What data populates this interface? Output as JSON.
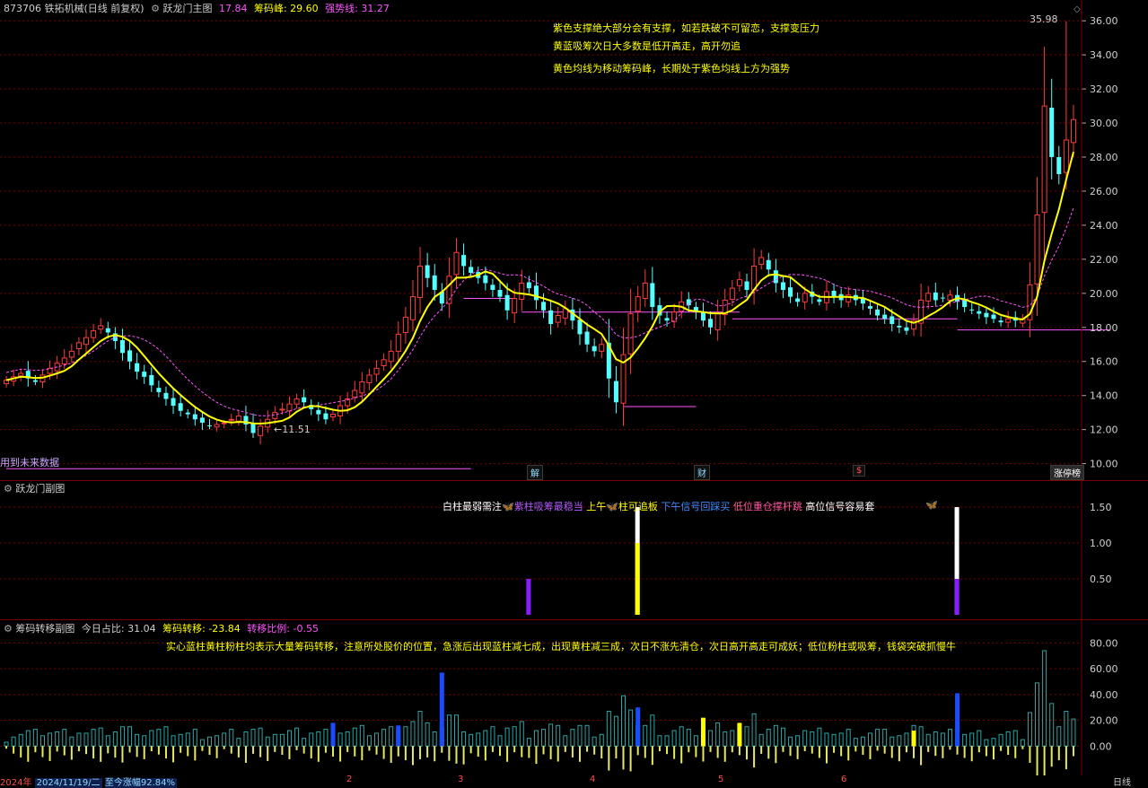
{
  "header": {
    "security": "873706 铁拓机械(日线 前复权)",
    "main_title": "跃龙门主图",
    "main_val_1": "17.84",
    "label_chip_peak": "筹码峰:",
    "val_chip_peak": "29.60",
    "label_strong": "强势线:",
    "val_strong": "31.27"
  },
  "notes": {
    "line1": "紫色支撑绝大部分会有支撑，如若跌破不可留恋，支撑变压力",
    "line2": "黄蓝吸筹次日大多数是低开高走，高开勿追",
    "line3": "黄色均线为移动筹码峰，长期处于紫色均线上方为强势"
  },
  "future_text": "用到未来数据",
  "markers": {
    "m_jie": "解",
    "m_cai": "财",
    "m_s": "$",
    "m_zt": "涨停榜"
  },
  "price_labels": {
    "high": "35.98",
    "low": "11.51"
  },
  "sub_panel": {
    "title": "跃龙门副图",
    "legend_1": "白柱最弱需注",
    "legend_2": "紫柱吸筹最稳当",
    "legend_3": "上午",
    "legend_4": "柱可追板",
    "legend_5": "下午信号回踩买",
    "legend_6": "低位重仓撑杆跳",
    "legend_7": "高位信号容易套",
    "ticks": [
      "1.50",
      "1.00",
      "0.50"
    ]
  },
  "flow_panel": {
    "title": "筹码转移副图",
    "label_today": "今日占比:",
    "val_today": "31.04",
    "label_transfer": "筹码转移:",
    "val_transfer": "-23.84",
    "label_ratio": "转移比例:",
    "val_ratio": "-0.55",
    "note": "实心蓝柱黄柱粉柱均表示大量筹码转移，注意所处股价的位置，急涨后出现蓝柱减七成，出现黄柱减三成，次日不涨先清仓，次日高开高走可成妖；低位粉柱或吸筹，钱袋突破抓慢牛",
    "ticks": [
      "80.00",
      "60.00",
      "40.00",
      "20.00",
      "0.00"
    ]
  },
  "bottom": {
    "year": "2024年",
    "date": "2024/11/19/二",
    "gain_label": "至今涨幅",
    "gain": "92.84%",
    "months": [
      "2",
      "3",
      "4",
      "5",
      "6"
    ],
    "period": "日线"
  },
  "colors": {
    "up": "#ff3b3b",
    "down": "#54ffff",
    "ma_yellow": "#ffff00",
    "ma_magenta": "#ff55ff",
    "grid": "#7a0000"
  },
  "chart_data": {
    "type": "candlestick",
    "y_ticks": [
      "36.00",
      "34.00",
      "32.00",
      "30.00",
      "28.00",
      "26.00",
      "24.00",
      "22.00",
      "20.00",
      "18.00",
      "16.00",
      "14.00",
      "12.00",
      "10.00"
    ],
    "ylim": [
      9.4,
      36.8
    ],
    "closes": [
      14.9,
      15.1,
      15.3,
      15.0,
      14.8,
      15.2,
      15.6,
      15.9,
      16.2,
      16.6,
      17.1,
      17.4,
      17.8,
      18.1,
      17.7,
      17.2,
      16.5,
      16.0,
      15.4,
      15.1,
      14.6,
      14.2,
      13.8,
      13.4,
      13.1,
      12.9,
      12.6,
      12.4,
      12.2,
      12.3,
      12.4,
      12.6,
      12.8,
      12.3,
      11.8,
      12.2,
      12.6,
      13.0,
      13.2,
      13.5,
      13.8,
      13.6,
      13.2,
      12.9,
      12.6,
      12.9,
      13.4,
      13.8,
      14.3,
      14.8,
      15.2,
      15.6,
      16.1,
      16.6,
      17.6,
      18.6,
      19.8,
      21.6,
      20.9,
      20.2,
      19.4,
      21.0,
      22.4,
      21.6,
      21.2,
      20.9,
      20.6,
      20.2,
      19.8,
      19.0,
      19.7,
      20.6,
      20.3,
      19.6,
      19.0,
      18.2,
      18.7,
      19.1,
      18.4,
      17.6,
      17.0,
      16.6,
      17.0,
      15.0,
      13.6,
      16.4,
      18.8,
      19.8,
      20.6,
      19.2,
      18.7,
      18.4,
      18.9,
      19.5,
      19.3,
      18.9,
      18.4,
      18.0,
      18.8,
      19.6,
      20.3,
      20.8,
      20.2,
      21.6,
      22.1,
      21.4,
      20.6,
      20.2,
      19.8,
      19.5,
      20.0,
      19.8,
      19.5,
      20.1,
      19.8,
      19.6,
      19.9,
      19.6,
      19.4,
      19.1,
      18.7,
      18.5,
      18.2,
      18.0,
      17.8,
      18.4,
      19.6,
      20.0,
      19.6,
      19.7,
      19.9,
      19.5,
      19.2,
      19.0,
      18.8,
      18.6,
      18.5,
      18.3,
      18.5,
      18.4,
      18.5,
      20.5,
      24.6,
      31.0,
      28.0,
      27.0,
      29.0,
      30.2
    ],
    "price_high": 35.98,
    "price_low": 11.51,
    "support_levels": [
      {
        "value": 13.35,
        "from_bar": 85,
        "to_bar": 95
      },
      {
        "value": 19.7,
        "from_bar": 63,
        "to_bar": 70
      },
      {
        "value": 18.9,
        "from_bar": 71,
        "to_bar": 101
      },
      {
        "value": 18.5,
        "from_bar": 100,
        "to_bar": 131
      },
      {
        "value": 17.85,
        "from_bar": 131,
        "to_bar": 152
      },
      {
        "value": 9.7,
        "from_bar": 0,
        "to_bar": 64
      }
    ],
    "signal_bars": [
      {
        "bar": 72,
        "white": 0,
        "purple": 0.5
      },
      {
        "bar": 87,
        "white": 1.5,
        "yellow": 1.0
      },
      {
        "bar": 131,
        "white": 1.5,
        "purple": 0.5
      }
    ],
    "flow_ylim": [
      -20,
      90
    ],
    "flow_highlights": [
      {
        "bar": 45,
        "value": 18,
        "color": "#1a4cff"
      },
      {
        "bar": 54,
        "value": 16,
        "color": "#1a4cff"
      },
      {
        "bar": 60,
        "value": 57,
        "color": "#1a4cff"
      },
      {
        "bar": 87,
        "value": 30,
        "color": "#1a4cff"
      },
      {
        "bar": 96,
        "value": 22,
        "color": "#ffff00"
      },
      {
        "bar": 101,
        "value": 18,
        "color": "#ffff00"
      },
      {
        "bar": 125,
        "value": 12,
        "color": "#ffff00"
      },
      {
        "bar": 131,
        "value": 41,
        "color": "#1a4cff"
      },
      {
        "bar": 148,
        "value": 79,
        "color": "#1a4cff"
      }
    ]
  }
}
